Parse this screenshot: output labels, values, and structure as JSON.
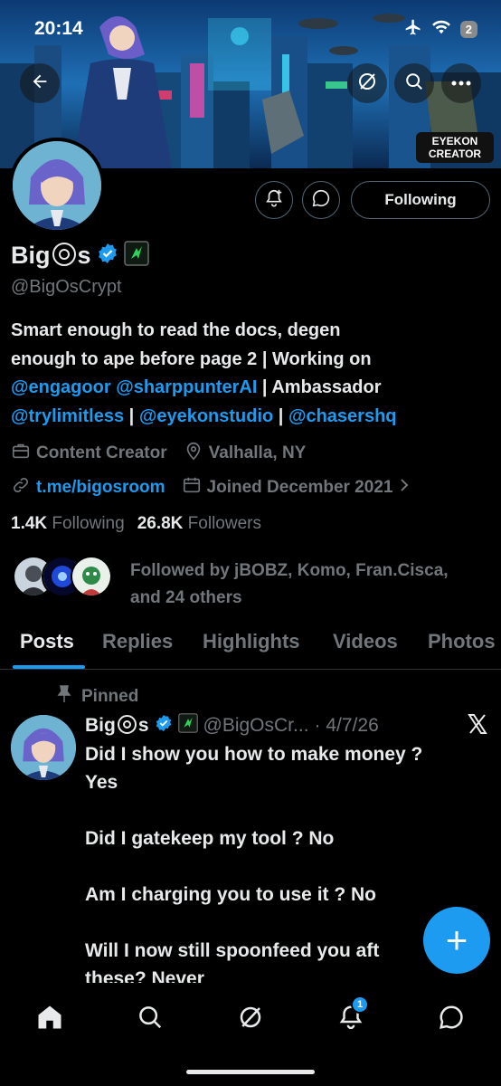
{
  "status_bar": {
    "time": "20:14",
    "battery": "2"
  },
  "banner": {
    "creator_badge_line1": "EYEKON",
    "creator_badge_line2": "CREATOR"
  },
  "header": {
    "following_label": "Following"
  },
  "profile": {
    "name_prefix": "Big",
    "name_suffix": "s",
    "handle": "@BigOsCrypt",
    "bio_line1": "Smart enough to read the docs, degen",
    "bio_line2": "enough to ape before page 2 | Working on",
    "bio_mention1": "@engagoor",
    "bio_mention2": "@sharppunterAI",
    "bio_text3": " | Ambassador",
    "bio_mention3": "@trylimitless",
    "bio_sep": " | ",
    "bio_mention4": "@eyekonstudio",
    "bio_mention5": "@chasershq",
    "category": "Content Creator",
    "location": "Valhalla, NY",
    "website": "t.me/bigosroom",
    "joined": "Joined December 2021",
    "following_count": "1.4K",
    "following_label": "Following",
    "followers_count": "26.8K",
    "followers_label": "Followers",
    "followed_by_line1": "Followed by jBOBZ, Komo, Fran.Cisca,",
    "followed_by_line2": "and 24 others"
  },
  "tabs": [
    {
      "label": "Posts"
    },
    {
      "label": "Replies"
    },
    {
      "label": "Highlights"
    },
    {
      "label": "Videos"
    },
    {
      "label": "Photos"
    }
  ],
  "post": {
    "pinned_label": "Pinned",
    "name_prefix": "Big",
    "name_suffix": "s",
    "handle": "@BigOsCr...",
    "date": "· 4/7/26",
    "body": "Did I show you how to make money ?\nYes\n\nDid I gatekeep my tool ? No\n\nAm I charging you to use it ? No\n\nWill I now still spoonfeed you aft\nthese? Never"
  },
  "fab": {
    "label": "+"
  },
  "bottom_nav": {
    "notifications_badge": "1"
  },
  "colors": {
    "accent": "#1d9bf0",
    "background": "#000000",
    "text": "#e7e9ea",
    "muted": "#71767b"
  }
}
